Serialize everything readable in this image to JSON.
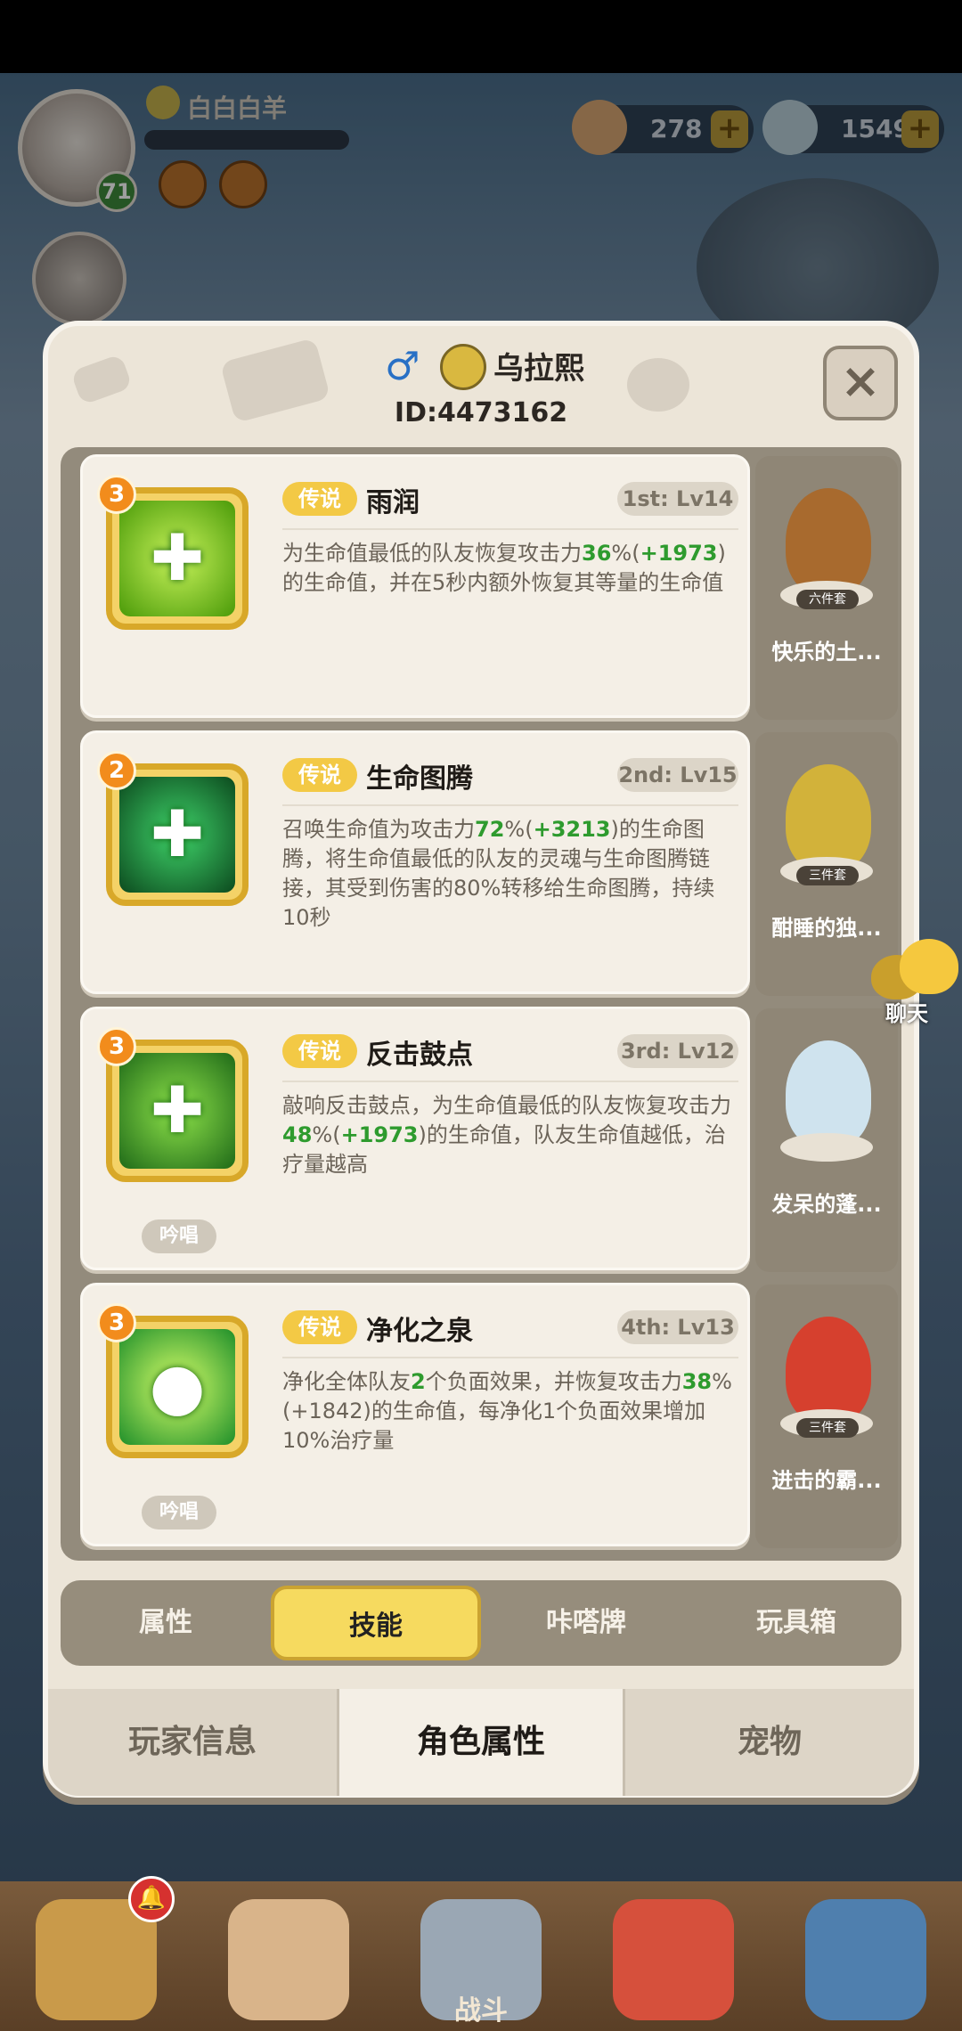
{
  "hud": {
    "player_name": "白白白羊",
    "level": "71",
    "resource_a": "278",
    "resource_b": "1549",
    "plus": "+"
  },
  "dialog": {
    "gender_symbol": "♂",
    "name": "乌拉熙",
    "id": "ID:4473162",
    "close": "×"
  },
  "skills": [
    {
      "badge": "3",
      "tag": "传说",
      "name": "雨润",
      "slot": "1st: Lv14",
      "desc_a": "为生命值最低的队友恢复攻击力",
      "hl_a": "36",
      "desc_b": "%(",
      "hl_b": "+1973",
      "desc_c": ")的生命值，并在5秒内额外恢复其等量的生命值",
      "chant": "",
      "icon_color": "#7fd11a"
    },
    {
      "badge": "2",
      "tag": "传说",
      "name": "生命图腾",
      "slot": "2nd: Lv15",
      "desc_a": "召唤生命值为攻击力",
      "hl_a": "72",
      "desc_b": "%(",
      "hl_b": "+3213",
      "desc_c": ")的生命图腾，将生命值最低的队友的灵魂与生命图腾链接，其受到伤害的80%转移给生命图腾，持续10秒",
      "chant": "",
      "icon_color": "#1f8f3c"
    },
    {
      "badge": "3",
      "tag": "传说",
      "name": "反击鼓点",
      "slot": "3rd: Lv12",
      "desc_a": "敲响反击鼓点，为生命值最低的队友恢复攻击力",
      "hl_a": "48",
      "desc_b": "%(",
      "hl_b": "+1973",
      "desc_c": ")的生命值，队友生命值越低，治疗量越高",
      "chant": "吟唱",
      "icon_color": "#2f9f33"
    },
    {
      "badge": "3",
      "tag": "传说",
      "name": "净化之泉",
      "slot": "4th: Lv13",
      "desc_a": "净化全体队友",
      "hl_a": "2",
      "desc_b": "个负面效果，并恢复攻击力",
      "hl_b": "38",
      "desc_c": "%(+1842)的生命值，每净化1个负面效果增加10%治疗量",
      "chant": "吟唱",
      "icon_color": "#27a53c"
    }
  ],
  "pets": [
    {
      "name": "快乐的土...",
      "set": "六件套",
      "color": "#a86a2e"
    },
    {
      "name": "酣睡的独...",
      "set": "三件套",
      "color": "#d2b23a"
    },
    {
      "name": "发呆的蓬...",
      "set": "",
      "color": "#cfe3ee"
    },
    {
      "name": "进击的霸...",
      "set": "三件套",
      "color": "#d6402e"
    }
  ],
  "sub_tabs": [
    "属性",
    "技能",
    "咔嗒牌",
    "玩具箱"
  ],
  "main_tabs": [
    "玩家信息",
    "角色属性",
    "宠物"
  ],
  "chat_label": "聊天",
  "bottom_nav": {
    "battle_label": "战斗"
  },
  "colors": {
    "accent": "#f6da5f",
    "highlight": "#2e9b2e",
    "legend_tag": "#f3c945"
  }
}
